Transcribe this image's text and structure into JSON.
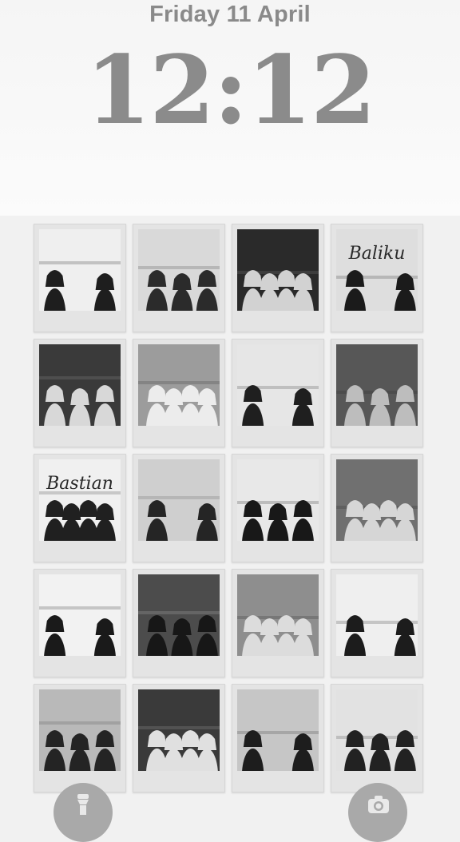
{
  "lock_screen": {
    "date": "Friday 11 April",
    "time": "12:12"
  },
  "wallpaper": {
    "photos": [
      {
        "caption": ""
      },
      {
        "caption": ""
      },
      {
        "caption": ""
      },
      {
        "caption": "Baliku"
      },
      {
        "caption": ""
      },
      {
        "caption": ""
      },
      {
        "caption": ""
      },
      {
        "caption": ""
      },
      {
        "caption": "Bastian"
      },
      {
        "caption": ""
      },
      {
        "caption": ""
      },
      {
        "caption": ""
      },
      {
        "caption": ""
      },
      {
        "caption": ""
      },
      {
        "caption": ""
      },
      {
        "caption": ""
      },
      {
        "caption": ""
      },
      {
        "caption": ""
      },
      {
        "caption": ""
      },
      {
        "caption": ""
      }
    ]
  },
  "quick_actions": {
    "left_icon": "flashlight-icon",
    "right_icon": "camera-icon"
  }
}
